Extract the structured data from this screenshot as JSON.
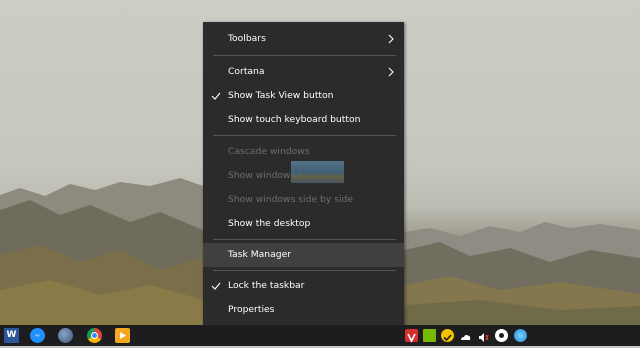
{
  "menu": {
    "items": [
      {
        "label": "Toolbars",
        "state": "enabled",
        "check": false,
        "submenu": true
      },
      {
        "label": "Cortana",
        "state": "enabled",
        "check": false,
        "submenu": true
      },
      {
        "label": "Show Task View button",
        "state": "enabled",
        "check": true,
        "submenu": false
      },
      {
        "label": "Show touch keyboard button",
        "state": "enabled",
        "check": false,
        "submenu": false
      },
      {
        "label": "Cascade windows",
        "state": "disabled",
        "check": false,
        "submenu": false
      },
      {
        "label": "Show windows s",
        "state": "disabled",
        "check": false,
        "submenu": false
      },
      {
        "label": "Show windows side by side",
        "state": "disabled",
        "check": false,
        "submenu": false
      },
      {
        "label": "Show the desktop",
        "state": "enabled",
        "check": false,
        "submenu": false
      },
      {
        "label": "Task Manager",
        "state": "highlighted",
        "check": false,
        "submenu": false
      },
      {
        "label": "Lock the taskbar",
        "state": "enabled",
        "check": true,
        "submenu": false
      },
      {
        "label": "Properties",
        "state": "enabled",
        "check": false,
        "submenu": false
      }
    ]
  },
  "taskbar": {
    "pinned": [
      {
        "name": "word-icon",
        "glyph": "W"
      },
      {
        "name": "messenger-icon",
        "glyph": ""
      },
      {
        "name": "globe-icon",
        "glyph": ""
      },
      {
        "name": "chrome-icon",
        "glyph": ""
      },
      {
        "name": "media-player-icon",
        "glyph": ""
      }
    ],
    "tray": [
      {
        "name": "vivaldi-icon"
      },
      {
        "name": "nvidia-icon"
      },
      {
        "name": "norton-icon"
      },
      {
        "name": "onedrive-icon"
      },
      {
        "name": "volume-icon"
      },
      {
        "name": "steam-icon"
      },
      {
        "name": "network-icon"
      }
    ]
  },
  "colors": {
    "menu_bg": "#2b2b2b",
    "menu_text": "#ffffff",
    "menu_disabled": "#6e6e6e",
    "menu_highlight": "#404040",
    "taskbar_bg": "#1d1d1f"
  }
}
